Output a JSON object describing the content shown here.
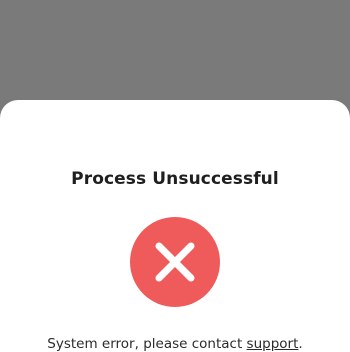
{
  "dialog": {
    "title": "Process Unsuccessful",
    "icon": "error-x-icon",
    "message_prefix": "System error, please contact ",
    "support_link": "support",
    "message_suffix": "."
  },
  "colors": {
    "overlay": "#7a7a7a",
    "sheet": "#ffffff",
    "error": "#ef5b5b"
  }
}
